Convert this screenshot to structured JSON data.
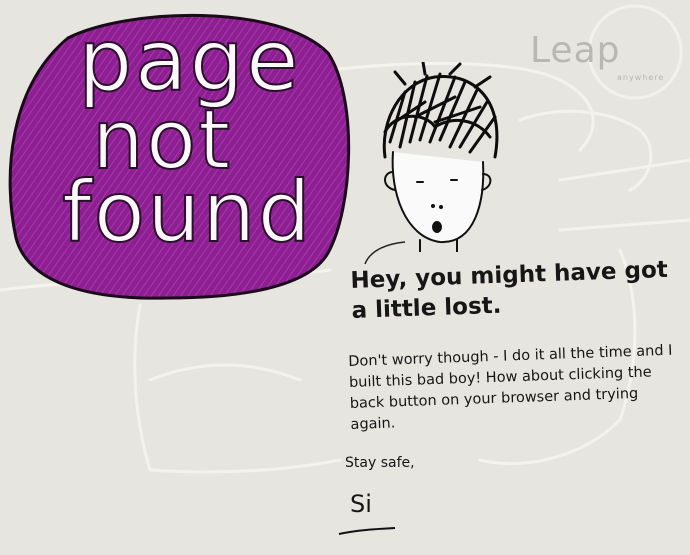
{
  "logo": {
    "name": "Leap",
    "tagline": "anywhere"
  },
  "bubble": {
    "line1": "page",
    "line2": "not",
    "line3": "found",
    "color": "#8a1d8f"
  },
  "message": {
    "headline": "Hey, you might have got a little lost.",
    "body": "Don't worry though - I do it all the time and I built this bad boy! How about clicking the back button on your browser and trying again.",
    "signoff": "Stay safe,",
    "signature": "Si"
  },
  "icons": {
    "character": "person-doodle-icon"
  }
}
